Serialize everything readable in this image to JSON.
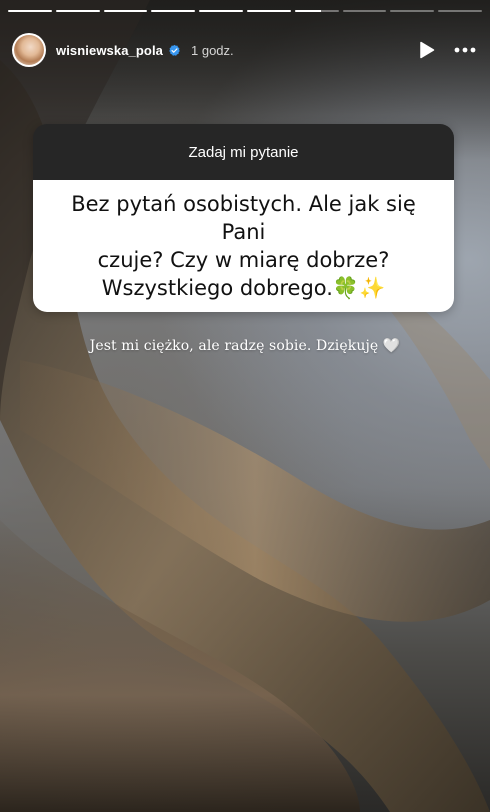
{
  "progress": {
    "segments": [
      1,
      1,
      1,
      1,
      1,
      1,
      0.6,
      0,
      0,
      0
    ]
  },
  "header": {
    "username": "wisniewska_pola",
    "time_ago": "1 godz.",
    "verified_icon": "verified-badge-icon",
    "play_icon": "play-icon",
    "more_icon": "more-horizontal-icon"
  },
  "question_card": {
    "title": "Zadaj mi pytanie",
    "lines": [
      "Bez pytań osobistych. Ale jak się Pani",
      "czuje? Czy w miarę dobrze?",
      "Wszystkiego dobrego.🍀✨"
    ]
  },
  "reply": {
    "text": "Jest mi ciężko, ale radzę sobie. Dziękuję 🤍"
  },
  "colors": {
    "card_header": "#262626",
    "card_body": "#ffffff",
    "verified": "#3897f0"
  }
}
